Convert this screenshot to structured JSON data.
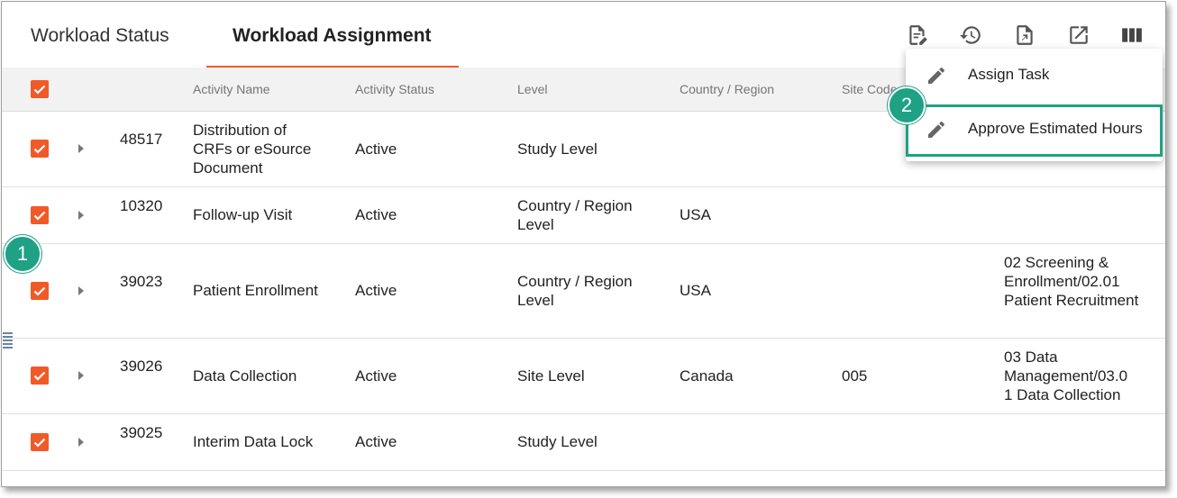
{
  "tabs": [
    {
      "label": "Workload Status"
    },
    {
      "label": "Workload Assignment",
      "active": true
    }
  ],
  "accent_color": "#f05a28",
  "callout_color": "#1ea185",
  "toolbar": {
    "icons": [
      "edit-document-icon",
      "history-icon",
      "export-document-icon",
      "open-external-icon",
      "columns-icon"
    ]
  },
  "table": {
    "columns": [
      "Activity Name",
      "Activity Status",
      "Level",
      "Country / Region",
      "Site Code"
    ],
    "rows": [
      {
        "id": "48517",
        "activity": "Distribution of CRFs or eSource Document",
        "status": "Active",
        "level": "Study Level",
        "country": "",
        "site": "",
        "task": ""
      },
      {
        "id": "10320",
        "activity": "Follow-up Visit",
        "status": "Active",
        "level": "Country / Region Level",
        "country": "USA",
        "site": "",
        "task": ""
      },
      {
        "id": "39023",
        "activity": "Patient Enrollment",
        "status": "Active",
        "level": "Country / Region Level",
        "country": "USA",
        "site": "",
        "task": "02 Screening & Enrollment/02.01 Patient Recruitment"
      },
      {
        "id": "39026",
        "activity": "Data Collection",
        "status": "Active",
        "level": "Site Level",
        "country": "Canada",
        "site": "005",
        "task": "03 Data Management/03.0 1 Data Collection"
      },
      {
        "id": "39025",
        "activity": "Interim Data Lock",
        "status": "Active",
        "level": "Study Level",
        "country": "",
        "site": "",
        "task": ""
      }
    ]
  },
  "menu": {
    "items": [
      {
        "label": "Assign Task",
        "icon": "pencil-icon"
      },
      {
        "label": "Approve Estimated Hours",
        "icon": "pencil-icon"
      }
    ]
  },
  "callouts": [
    "1",
    "2"
  ]
}
